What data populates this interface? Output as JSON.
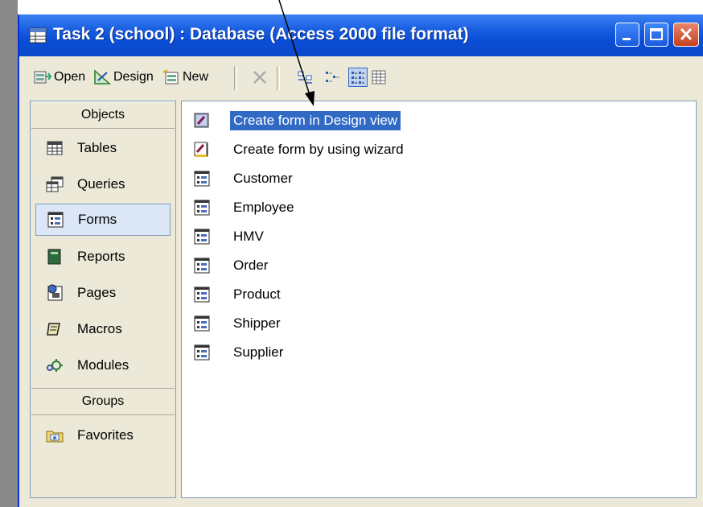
{
  "window": {
    "title": "Task 2 (school) : Database (Access 2000 file format)"
  },
  "toolbar": {
    "open_label": "Open",
    "design_label": "Design",
    "new_label": "New"
  },
  "sidebar": {
    "objects_header": "Objects",
    "groups_header": "Groups",
    "items": [
      {
        "label": "Tables",
        "icon": "table-icon"
      },
      {
        "label": "Queries",
        "icon": "query-icon"
      },
      {
        "label": "Forms",
        "icon": "form-icon"
      },
      {
        "label": "Reports",
        "icon": "report-icon"
      },
      {
        "label": "Pages",
        "icon": "page-icon"
      },
      {
        "label": "Macros",
        "icon": "macro-icon"
      },
      {
        "label": "Modules",
        "icon": "module-icon"
      }
    ],
    "favorites_label": "Favorites"
  },
  "list": {
    "items": [
      {
        "label": "Create form in Design view",
        "icon": "design-wizard-icon"
      },
      {
        "label": "Create form by using wizard",
        "icon": "wizard-icon"
      },
      {
        "label": "Customer",
        "icon": "form-icon"
      },
      {
        "label": "Employee",
        "icon": "form-icon"
      },
      {
        "label": "HMV",
        "icon": "form-icon"
      },
      {
        "label": "Order",
        "icon": "form-icon"
      },
      {
        "label": "Product",
        "icon": "form-icon"
      },
      {
        "label": "Shipper",
        "icon": "form-icon"
      },
      {
        "label": "Supplier",
        "icon": "form-icon"
      }
    ]
  },
  "colors": {
    "titlebar": "#0a4ed8",
    "selection": "#316ac5"
  }
}
